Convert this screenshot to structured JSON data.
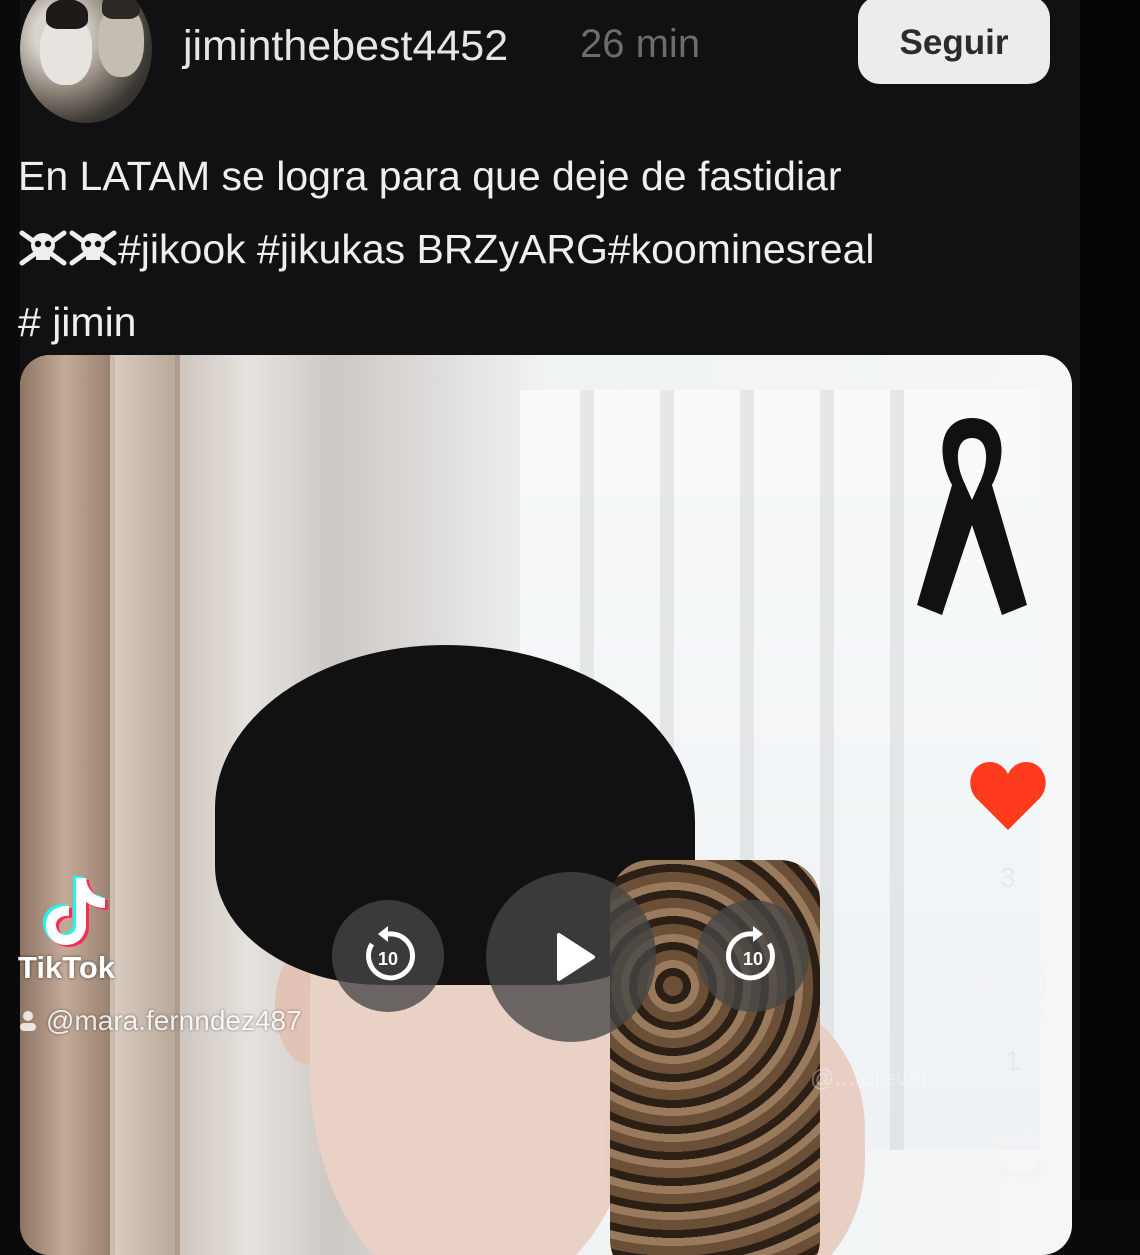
{
  "post": {
    "username": "jiminthebest4452",
    "time": "26 min",
    "follow_label": "Seguir",
    "caption_line1": "En LATAM se logra para que deje de fastidiar",
    "caption_line2_tags": "#jikook #jikukas BRZyARG#koominesreal",
    "caption_line3": "# jimin"
  },
  "video": {
    "tiktok_brand": "TikTok",
    "tiktok_handle": "@mara.fernndez487",
    "watermark": "@...forever",
    "like_count": "3",
    "comment_count": "1",
    "rewind_seconds": "10",
    "forward_seconds": "10"
  },
  "colors": {
    "heart": "#ff3b1f",
    "follow_bg": "#ececec",
    "background": "#0b0a0b"
  }
}
